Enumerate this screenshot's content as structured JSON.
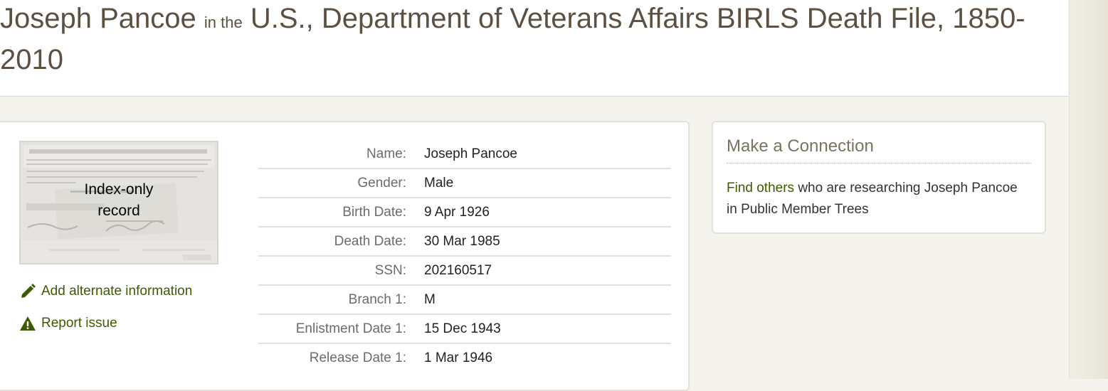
{
  "header": {
    "person_name": "Joseph Pancoe",
    "connector": "in the",
    "collection_title": "U.S., Department of Veterans Affairs BIRLS Death File, 1850-2010"
  },
  "record_image": {
    "label": "Index-only\nrecord",
    "icon": "census-record-thumbnail"
  },
  "actions": {
    "add_alternate": {
      "label": "Add alternate information",
      "icon": "pencil-icon"
    },
    "report_issue": {
      "label": "Report issue",
      "icon": "warning-icon"
    }
  },
  "facts": [
    {
      "label": "Name:",
      "value": "Joseph Pancoe"
    },
    {
      "label": "Gender:",
      "value": "Male"
    },
    {
      "label": "Birth Date:",
      "value": "9 Apr 1926"
    },
    {
      "label": "Death Date:",
      "value": "30 Mar 1985"
    },
    {
      "label": "SSN:",
      "value": "202160517"
    },
    {
      "label": "Branch 1:",
      "value": "M"
    },
    {
      "label": "Enlistment Date 1:",
      "value": "15 Dec 1943"
    },
    {
      "label": "Release Date 1:",
      "value": "1 Mar 1946"
    }
  ],
  "connection": {
    "title": "Make a Connection",
    "link_text": "Find others",
    "text": " who are researching Joseph Pancoe in Public Member Trees"
  },
  "colors": {
    "title_text": "#5b5042",
    "link_green": "#3c5a00",
    "background": "#f4f3ee"
  }
}
